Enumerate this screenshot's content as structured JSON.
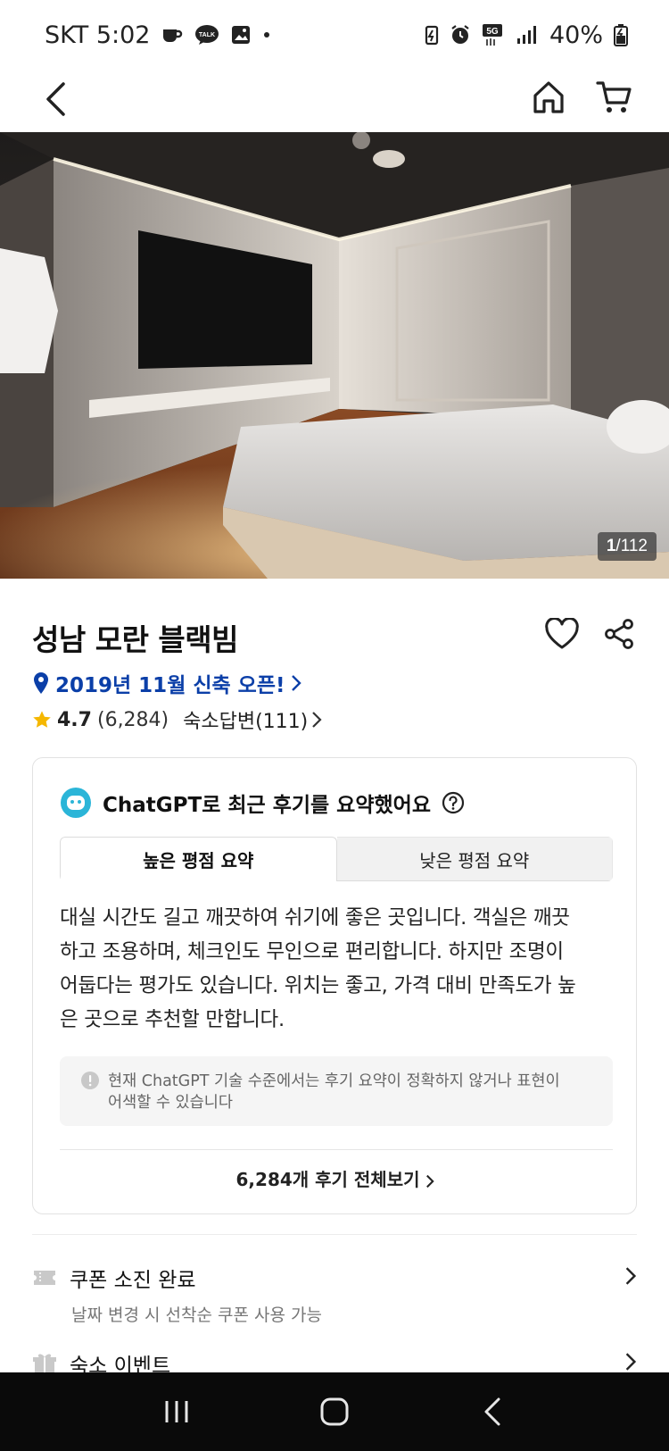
{
  "status_bar": {
    "carrier_time": "SKT 5:02",
    "network": "5G",
    "battery": "40%"
  },
  "nav": {
    "back": "back",
    "home": "home",
    "cart": "cart"
  },
  "gallery": {
    "current": "1",
    "total": "/112"
  },
  "property": {
    "name": "성남 모란 블랙빔",
    "location_text": "2019년 11월 신축 오픈!",
    "rating": "4.7",
    "review_count": "(6,284)",
    "reply_label": "숙소답변(111)"
  },
  "summary": {
    "header": "ChatGPT로 최근 후기를 요약했어요",
    "tabs": [
      {
        "label": "높은 평점 요약",
        "active": true
      },
      {
        "label": "낮은 평점 요약",
        "active": false
      }
    ],
    "lines": [
      "대실 시간도 길고 깨끗하여 쉬기에 좋은 곳입니다. 객실은 깨끗",
      "하고 조용하며, 체크인도 무인으로 편리합니다. 하지만 조명이",
      "어둡다는 평가도 있습니다. 위치는 좋고, 가격 대비 만족도가 높",
      "은 곳으로 추천할 만합니다."
    ],
    "notice_lines": [
      "현재 ChatGPT 기술 수준에서는 후기 요약이 정확하지 않거나 표현이",
      "어색할 수 있습니다"
    ],
    "view_all": "6,284개 후기 전체보기"
  },
  "rows": [
    {
      "title": "쿠폰 소진 완료",
      "subtitle": "날짜 변경 시 선착순 쿠폰 사용 가능",
      "icon": "coupon-icon"
    },
    {
      "title": "숙소 이벤트",
      "icon": "gift-icon"
    }
  ],
  "colors": {
    "accent_blue": "#0b3fa8",
    "star": "#f5b700",
    "bot": "#2bb5d8"
  }
}
